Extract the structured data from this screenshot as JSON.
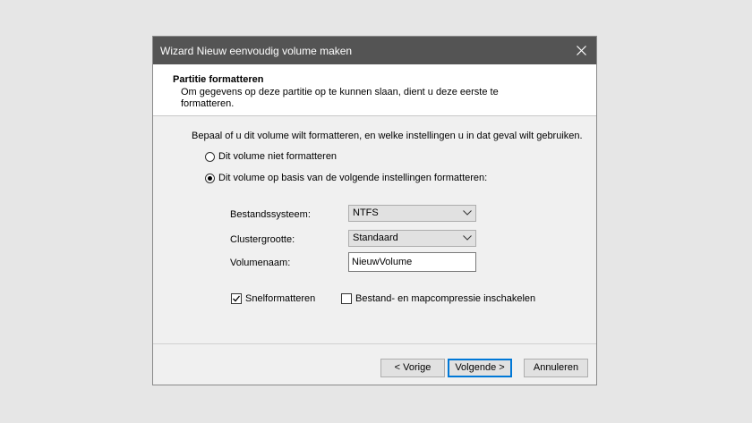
{
  "window": {
    "title": "Wizard Nieuw eenvoudig volume maken"
  },
  "header": {
    "title": "Partitie formatteren",
    "description": "Om gegevens op deze partitie op te kunnen slaan, dient u deze eerste te formatteren."
  },
  "body": {
    "intro": "Bepaal of u dit volume wilt formatteren, en welke instellingen u in dat geval wilt gebruiken.",
    "option_no_format": "Dit volume niet formatteren",
    "option_format": "Dit volume op basis van de volgende instellingen formatteren:",
    "selected_option": "format"
  },
  "settings": {
    "filesystem_label": "Bestandssysteem:",
    "filesystem_value": "NTFS",
    "cluster_label": "Clustergrootte:",
    "cluster_value": "Standaard",
    "volume_label": "Volumenaam:",
    "volume_value": "NieuwVolume"
  },
  "checkboxes": {
    "quick_format": {
      "label": "Snelformatteren",
      "checked": true
    },
    "compression": {
      "label": "Bestand- en mapcompressie inschakelen",
      "checked": false
    }
  },
  "buttons": {
    "back": "< Vorige",
    "next": "Volgende >",
    "cancel": "Annuleren"
  },
  "icons": {
    "close": "close-icon",
    "dropdown": "chevron-down-icon",
    "check": "checkmark-icon"
  },
  "colors": {
    "titlebar": "#545454",
    "accent": "#0078d7"
  }
}
